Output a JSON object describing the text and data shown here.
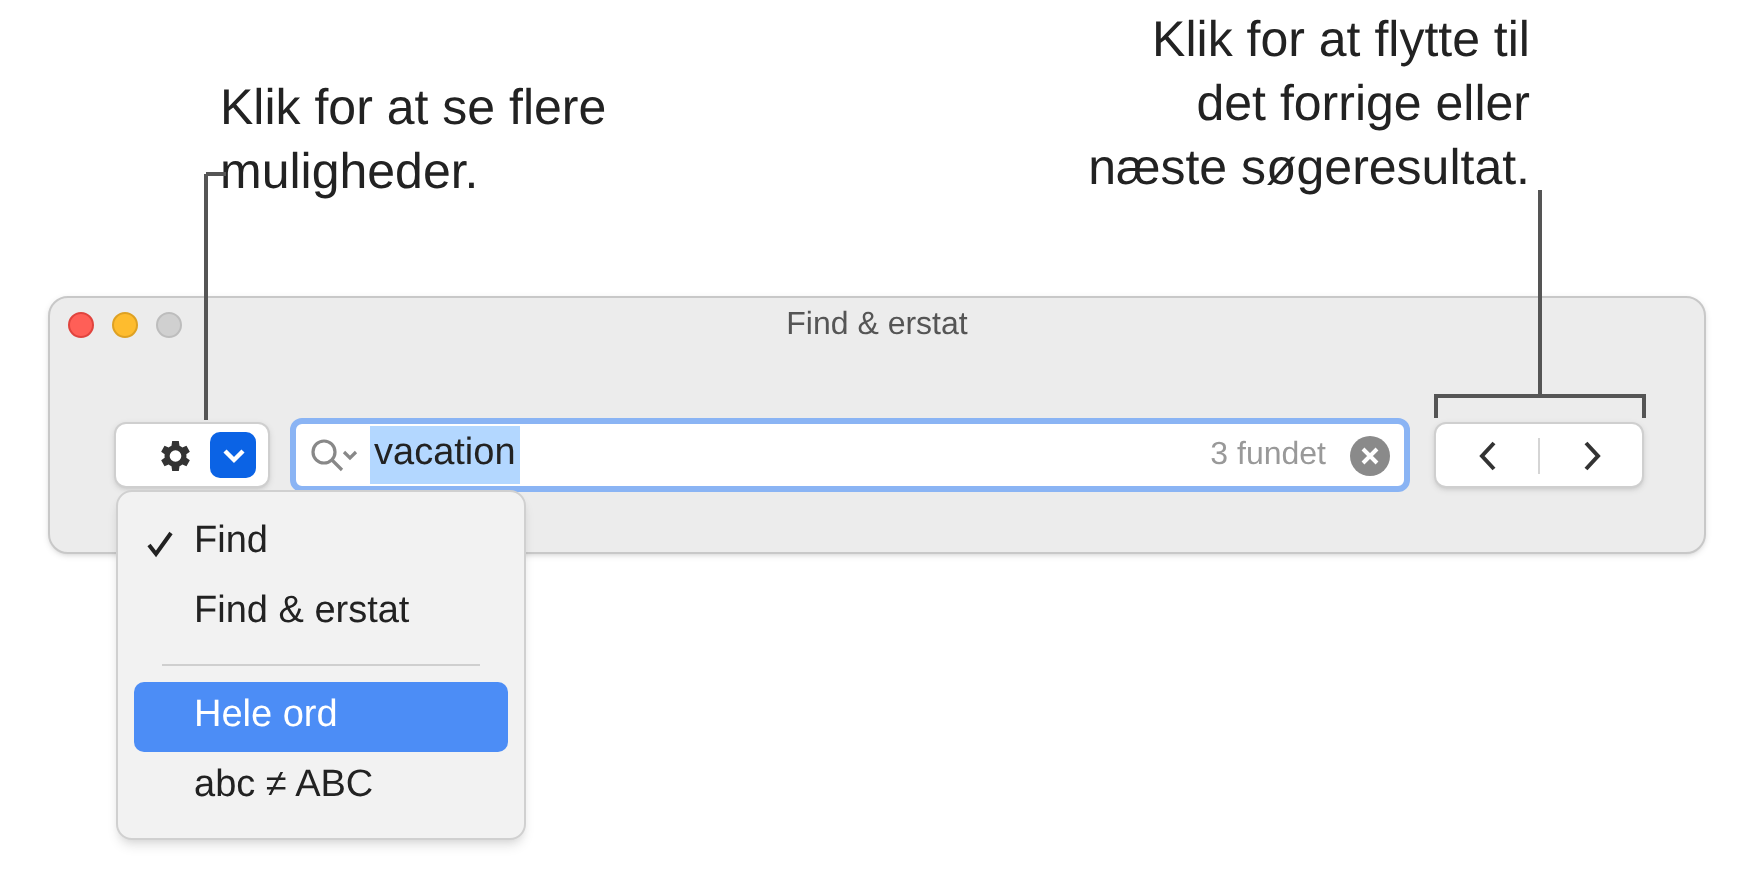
{
  "callouts": [
    {
      "lines": [
        "Klik for at se flere",
        "muligheder."
      ]
    },
    {
      "lines": [
        "Klik for at flytte til",
        "det forrige eller",
        "næste søgeresultat."
      ]
    }
  ],
  "window": {
    "title": "Find & erstat"
  },
  "search": {
    "value": "vacation",
    "count": "3 fundet"
  },
  "menu": {
    "items": [
      {
        "kind": "option",
        "label": "Find",
        "checked": true,
        "selected": false
      },
      {
        "kind": "option",
        "label": "Find & erstat",
        "checked": false,
        "selected": false
      },
      {
        "kind": "separator"
      },
      {
        "kind": "option",
        "label": "Hele ord",
        "checked": false,
        "selected": true
      },
      {
        "kind": "option",
        "label": "abc ≠ ABC",
        "checked": false,
        "selected": false
      }
    ]
  }
}
